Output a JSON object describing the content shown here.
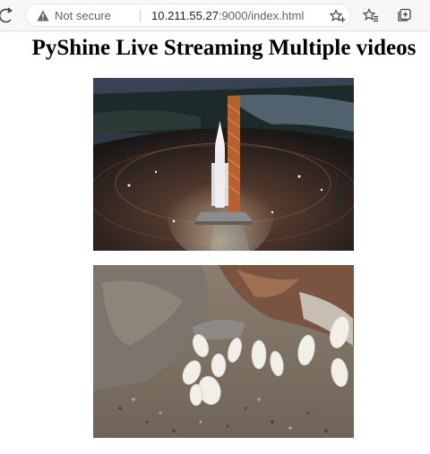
{
  "browser": {
    "security_label": "Not secure",
    "url_host": "10.211.55.27",
    "url_rest": ":9000/index.html"
  },
  "page": {
    "title": "PyShine Live Streaming Multiple videos",
    "videos": [
      {
        "subject": "rocket on launch pad at night"
      },
      {
        "subject": "white butterflies on gravel ground"
      }
    ]
  },
  "icons": {
    "reload": "reload-icon",
    "warning": "warning-icon",
    "add_favorite": "add-favorite-icon",
    "favorites": "favorites-icon",
    "collections": "collections-icon"
  }
}
